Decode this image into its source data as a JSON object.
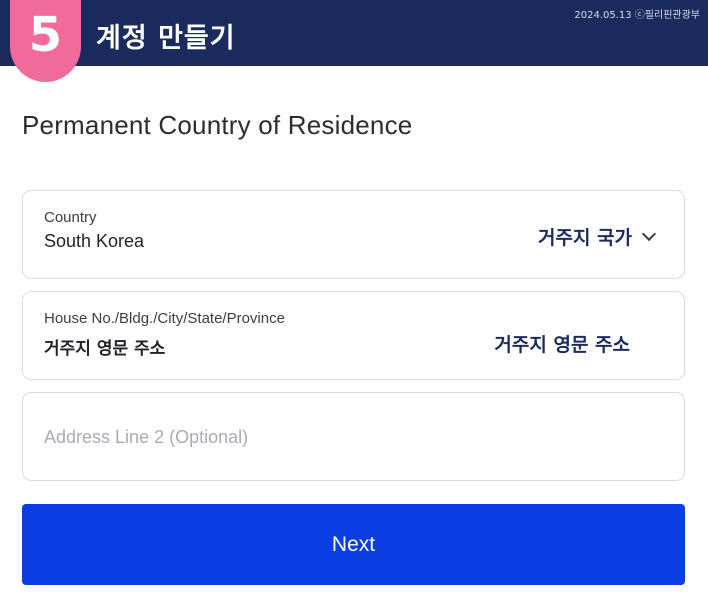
{
  "header": {
    "step_number": "5",
    "title": "계정 만들기",
    "credit": "2024.05.13 ⓒ필리핀관광부"
  },
  "page": {
    "title": "Permanent Country of Residence"
  },
  "fields": {
    "country": {
      "label": "Country",
      "value": "South Korea",
      "annotation": "거주지 국가",
      "icon": "chevron-down-icon"
    },
    "address_line_1": {
      "label": "House No./Bldg./City/State/Province",
      "value": "거주지 영문 주소",
      "annotation": "거주지 영문 주소"
    },
    "address_line_2": {
      "placeholder": "Address Line 2 (Optional)",
      "value": ""
    }
  },
  "actions": {
    "next_label": "Next"
  },
  "colors": {
    "header_bg": "#1c2b5e",
    "badge": "#f06a9a",
    "primary_button": "#0a3ee2",
    "annotation_text": "#1c2b5e"
  }
}
